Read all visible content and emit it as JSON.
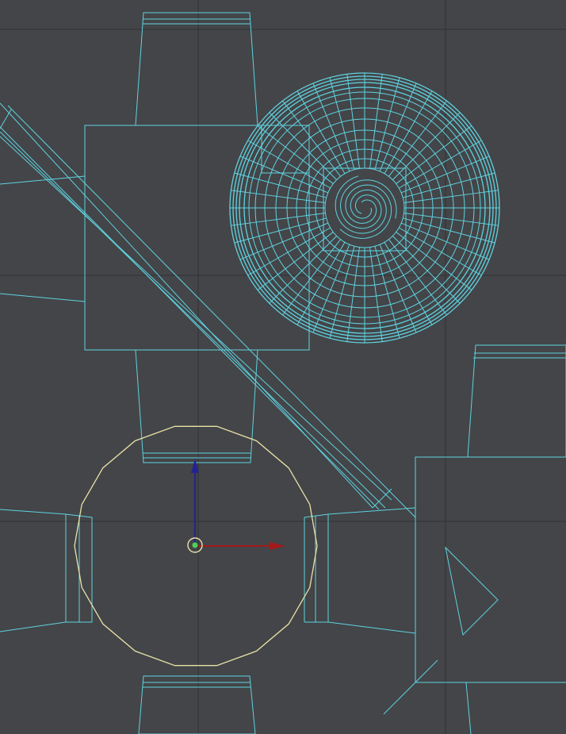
{
  "viewport": {
    "view": "top",
    "shading": "wireframe",
    "background_color": "#434548",
    "wire_color": "#5fd2e0",
    "grid_color": "#2f3133",
    "selection_color": "#e9e1a8"
  },
  "gizmo": {
    "tool": "move",
    "x_axis_color": "#a21a1a",
    "y_axis_color": "#23238f",
    "pivot_color": "#4dd05a"
  },
  "objects": [
    {
      "name": "wheel-mesh",
      "type": "sphere-wireframe"
    },
    {
      "name": "diagonal-beam",
      "type": "box"
    },
    {
      "name": "hub-block-top",
      "type": "box"
    },
    {
      "name": "hub-block-right",
      "type": "box"
    },
    {
      "name": "selected-circle",
      "type": "circle-spline"
    }
  ]
}
